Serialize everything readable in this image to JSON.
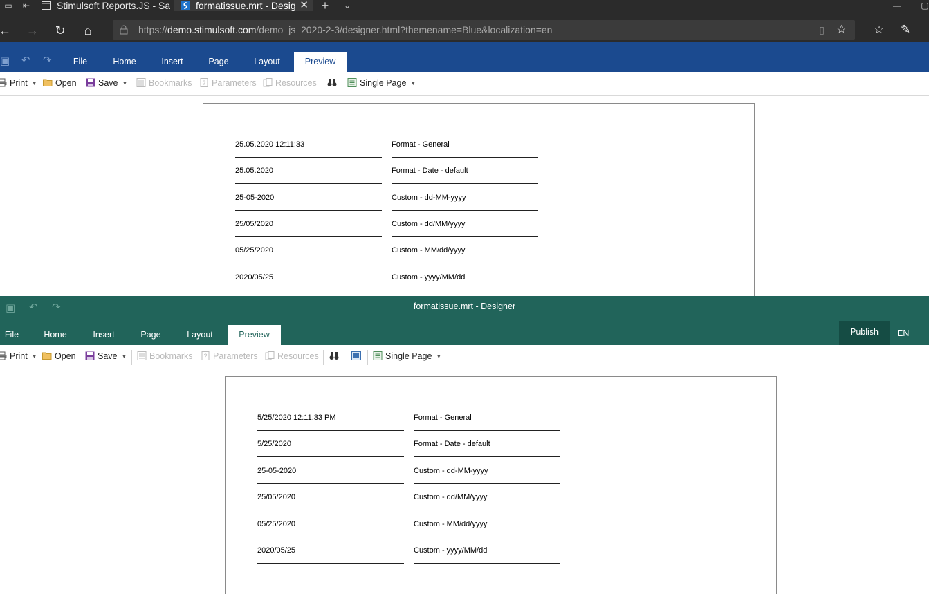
{
  "browser": {
    "tabs": [
      {
        "title": "Stimulsoft Reports.JS - Sam"
      },
      {
        "title": "formatissue.mrt - Desig"
      }
    ],
    "url": {
      "scheme": "https://",
      "domain": "demo.stimulsoft.com",
      "path": "/demo_js_2020-2-3/designer.html?themename=Blue&localization=en"
    }
  },
  "designer1": {
    "menu_tabs": [
      "File",
      "Home",
      "Insert",
      "Page",
      "Layout",
      "Preview"
    ],
    "active_tab": "Preview",
    "toolbar": {
      "print": "Print",
      "open": "Open",
      "save": "Save",
      "bookmarks": "Bookmarks",
      "parameters": "Parameters",
      "resources": "Resources",
      "view_mode": "Single Page"
    },
    "rows": [
      {
        "value": "25.05.2020 12:11:33",
        "format": "Format - General"
      },
      {
        "value": "25.05.2020",
        "format": "Format - Date - default"
      },
      {
        "value": "25-05-2020",
        "format": "Custom - dd-MM-yyyy"
      },
      {
        "value": "25/05/2020",
        "format": "Custom - dd/MM/yyyy"
      },
      {
        "value": "05/25/2020",
        "format": "Custom - MM/dd/yyyy"
      },
      {
        "value": "2020/05/25",
        "format": "Custom - yyyy/MM/dd"
      }
    ],
    "accent": "#1b4a8f"
  },
  "designer2": {
    "title": "formatissue.mrt - Designer",
    "menu_tabs": [
      "File",
      "Home",
      "Insert",
      "Page",
      "Layout",
      "Preview"
    ],
    "active_tab": "Preview",
    "publish": "Publish",
    "language": "EN",
    "toolbar": {
      "print": "Print",
      "open": "Open",
      "save": "Save",
      "bookmarks": "Bookmarks",
      "parameters": "Parameters",
      "resources": "Resources",
      "view_mode": "Single Page"
    },
    "rows": [
      {
        "value": "5/25/2020 12:11:33 PM",
        "format": "Format - General"
      },
      {
        "value": "5/25/2020",
        "format": "Format - Date - default"
      },
      {
        "value": "25-05-2020",
        "format": "Custom - dd-MM-yyyy"
      },
      {
        "value": "25/05/2020",
        "format": "Custom - dd/MM/yyyy"
      },
      {
        "value": "05/25/2020",
        "format": "Custom - MM/dd/yyyy"
      },
      {
        "value": "2020/05/25",
        "format": "Custom - yyyy/MM/dd"
      }
    ],
    "accent": "#21645a"
  }
}
